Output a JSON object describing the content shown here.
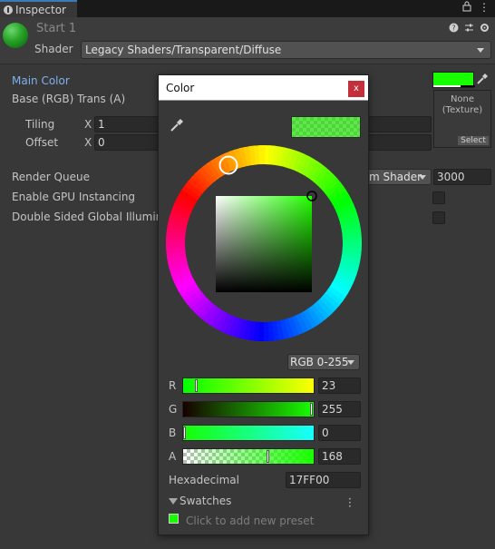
{
  "tab": {
    "label": "Inspector"
  },
  "header": {
    "object_name": "Start 1",
    "shader_label": "Shader",
    "shader_value": "Legacy Shaders/Transparent/Diffuse"
  },
  "props": {
    "main_color": "Main Color",
    "base_label": "Base (RGB) Trans (A)",
    "tiling": "Tiling",
    "offset": "Offset",
    "x": "X",
    "tiling_x": "1",
    "offset_x": "0",
    "texture_none": "None\n(Texture)",
    "select": "Select",
    "render_queue": "Render Queue",
    "rq_mode": "m Shader",
    "rq_value": "3000",
    "gpu": "Enable GPU Instancing",
    "dsgi": "Double Sided Global Illumina"
  },
  "color_window": {
    "title": "Color",
    "close": "x",
    "mode": "RGB 0-255",
    "channels": [
      {
        "name": "R",
        "value": "23",
        "level": 0.09
      },
      {
        "name": "G",
        "value": "255",
        "level": 1.0
      },
      {
        "name": "B",
        "value": "0",
        "level": 0.0
      },
      {
        "name": "A",
        "value": "168",
        "level": 0.66
      }
    ],
    "hex_label": "Hexadecimal",
    "hex_value": "17FF00",
    "swatches": "Swatches",
    "preset_hint": "Click to add new preset"
  },
  "colors": {
    "current": "#17ff00",
    "accent_label": "#7fb0ef",
    "close_bg": "#c4303a"
  },
  "icons": [
    "info-icon",
    "lock-icon",
    "more-icon",
    "help-icon",
    "preset-icon",
    "settings-icon",
    "eyedropper-icon",
    "close-icon"
  ]
}
